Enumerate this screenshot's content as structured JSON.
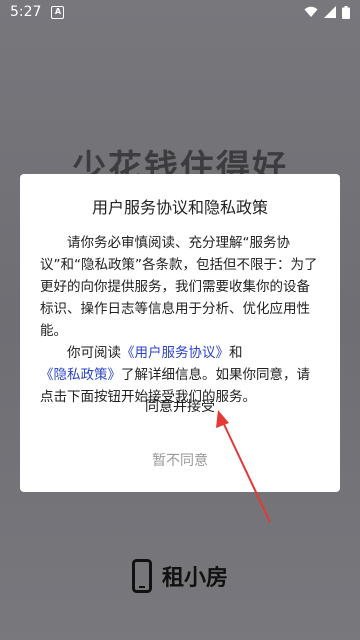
{
  "status_bar": {
    "time": "5:27"
  },
  "background": {
    "slogan": "少花钱住得好"
  },
  "dialog": {
    "title": "用户服务协议和隐私政策",
    "para1": "请你务必审慎阅读、充分理解“服务协议”和“隐私政策”各条款，包括但不限于：为了更好的向你提供服务，我们需要收集你的设备标识、操作日志等信息用于分析、优化应用性能。",
    "para2_prefix": "你可阅读",
    "link_service": "《用户服务协议》",
    "para2_and": "和",
    "link_privacy": "《隐私政策》",
    "para2_suffix": "了解详细信息。如果你同意，请点击下面按钮开始接受我们的服务。",
    "agree_label": "同意并接受",
    "disagree_label": "暂不同意"
  },
  "brand": {
    "name": "租小房"
  },
  "colors": {
    "link": "#2b45c8",
    "arrow": "#e53935"
  }
}
